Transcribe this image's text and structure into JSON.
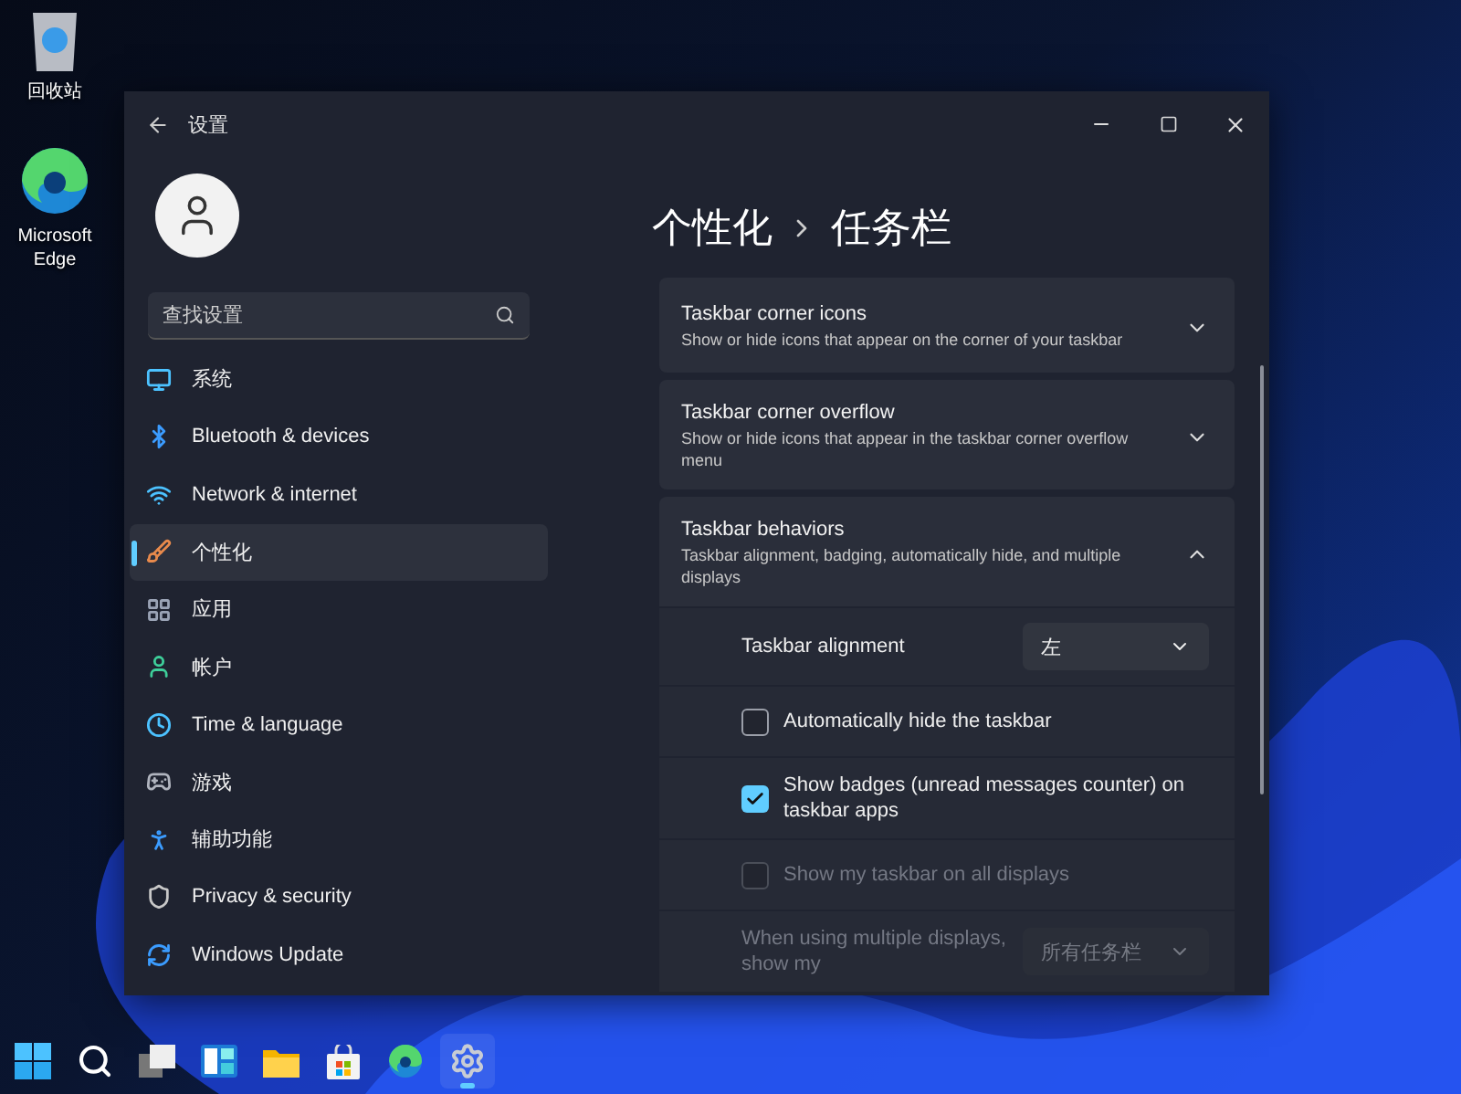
{
  "desktop_icons": [
    {
      "kind": "recycle",
      "label": "回收站"
    },
    {
      "kind": "edge",
      "label": "Microsoft Edge"
    }
  ],
  "window": {
    "title": "设置"
  },
  "search": {
    "placeholder": "查找设置"
  },
  "nav": [
    {
      "kind": "system",
      "label": "系统",
      "selected": false
    },
    {
      "kind": "bluetooth",
      "label": "Bluetooth & devices",
      "selected": false
    },
    {
      "kind": "network",
      "label": "Network & internet",
      "selected": false
    },
    {
      "kind": "personalize",
      "label": "个性化",
      "selected": true
    },
    {
      "kind": "apps",
      "label": "应用",
      "selected": false
    },
    {
      "kind": "account",
      "label": "帐户",
      "selected": false
    },
    {
      "kind": "time",
      "label": "Time & language",
      "selected": false
    },
    {
      "kind": "gaming",
      "label": "游戏",
      "selected": false
    },
    {
      "kind": "accessibility",
      "label": "辅助功能",
      "selected": false
    },
    {
      "kind": "privacy",
      "label": "Privacy & security",
      "selected": false
    },
    {
      "kind": "update",
      "label": "Windows Update",
      "selected": false
    }
  ],
  "breadcrumb": [
    "个性化",
    "任务栏"
  ],
  "sections": [
    {
      "title": "Taskbar corner icons",
      "description": "Show or hide icons that appear on the corner of your taskbar",
      "expanded": false
    },
    {
      "title": "Taskbar corner overflow",
      "description": "Show or hide icons that appear in the taskbar corner overflow menu",
      "expanded": false
    },
    {
      "title": "Taskbar behaviors",
      "description": "Taskbar alignment, badging, automatically hide, and multiple displays",
      "expanded": true,
      "settings": [
        {
          "kind": "dropdown",
          "label": "Taskbar alignment",
          "value": "左",
          "disabled": false
        },
        {
          "kind": "checkbox",
          "label": "Automatically hide the taskbar",
          "checked": false,
          "disabled": false
        },
        {
          "kind": "checkbox",
          "label": "Show badges (unread messages counter) on taskbar apps",
          "checked": true,
          "disabled": false
        },
        {
          "kind": "checkbox",
          "label": "Show my taskbar on all displays",
          "checked": false,
          "disabled": true
        },
        {
          "kind": "dropdown",
          "label": "When using multiple displays, show my",
          "value": "所有任务栏",
          "disabled": true
        }
      ]
    }
  ],
  "taskbar": [
    {
      "kind": "start",
      "selected": false
    },
    {
      "kind": "search",
      "selected": false
    },
    {
      "kind": "taskview",
      "selected": false
    },
    {
      "kind": "widgets",
      "selected": false
    },
    {
      "kind": "explorer",
      "selected": false
    },
    {
      "kind": "store",
      "selected": false
    },
    {
      "kind": "edge",
      "selected": false
    },
    {
      "kind": "settings",
      "selected": true
    }
  ]
}
